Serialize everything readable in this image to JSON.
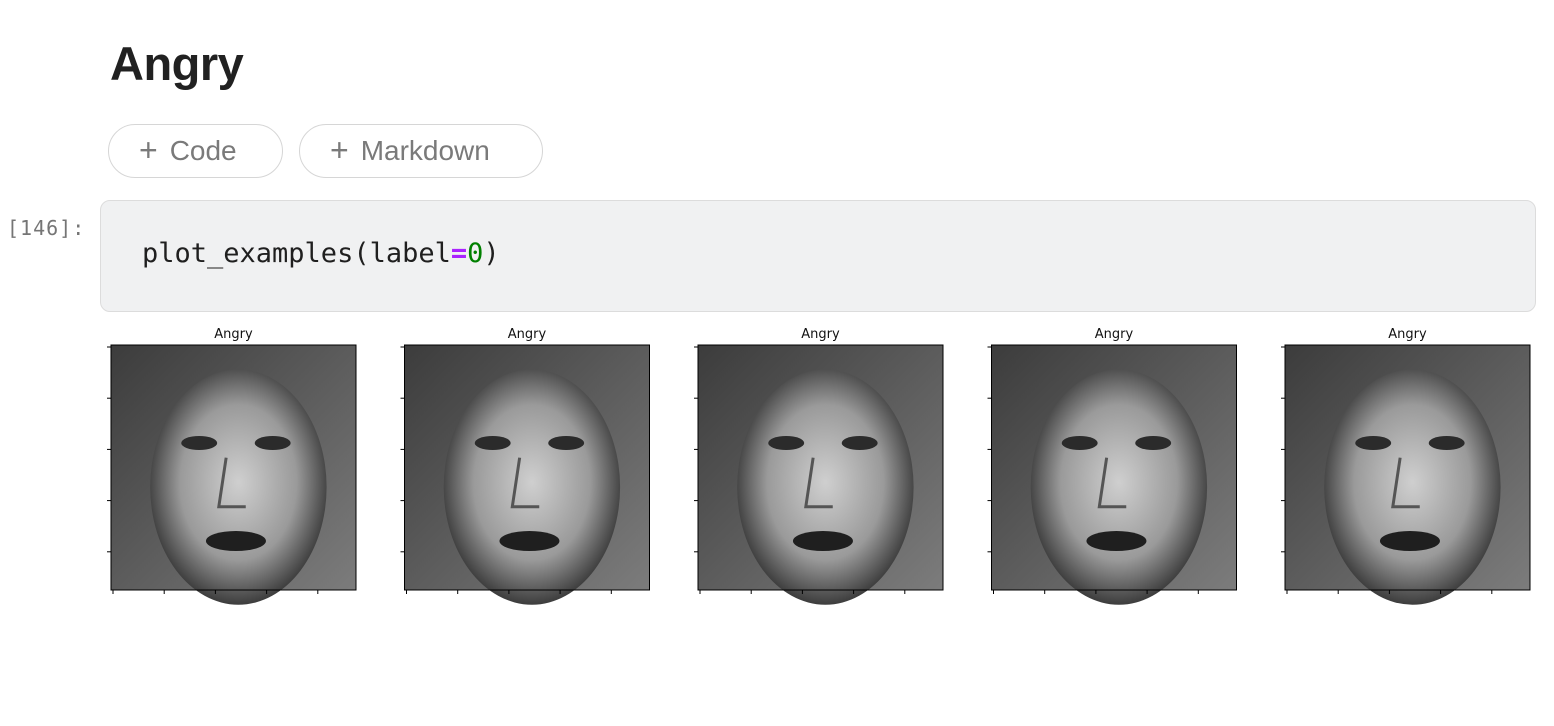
{
  "markdown": {
    "heading": "Angry"
  },
  "toolbar": {
    "add_code_label": "Code",
    "add_markdown_label": "Markdown",
    "plus_icon": "+"
  },
  "cell": {
    "prompt": "[146]:",
    "code": {
      "func": "plot_examples(label",
      "op": "=",
      "num": "0",
      "close": ")"
    }
  },
  "output": {
    "images": [
      {
        "title": "Angry",
        "icon": "face-photo-icon"
      },
      {
        "title": "Angry",
        "icon": "face-photo-icon"
      },
      {
        "title": "Angry",
        "icon": "face-photo-icon"
      },
      {
        "title": "Angry",
        "icon": "face-photo-icon"
      },
      {
        "title": "Angry",
        "icon": "face-photo-icon"
      }
    ]
  }
}
